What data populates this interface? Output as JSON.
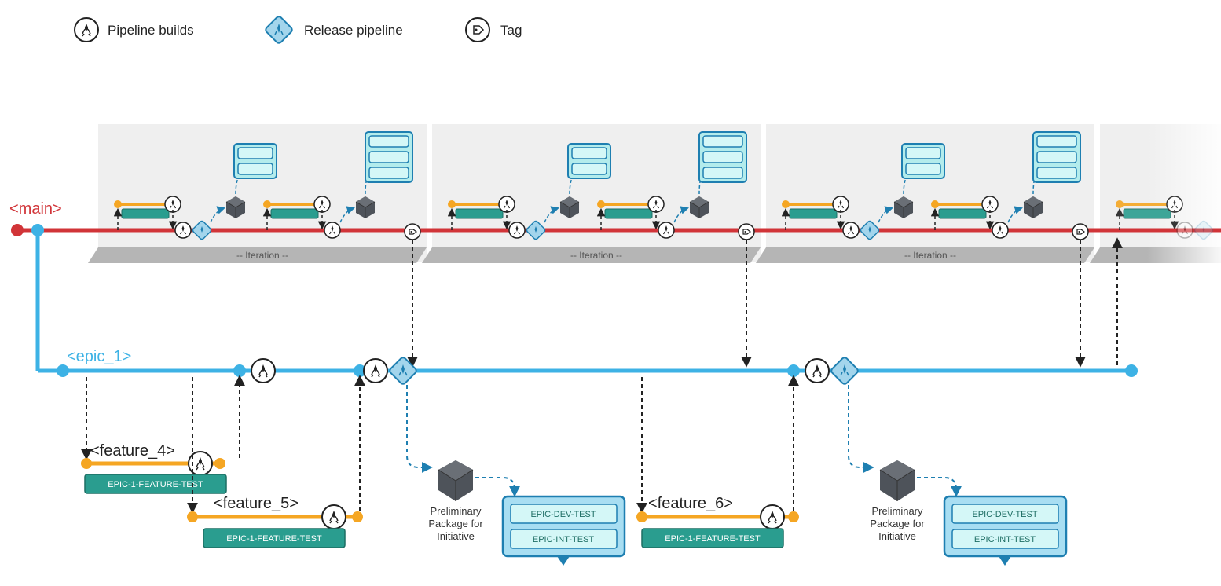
{
  "legend": {
    "pipeline_builds": "Pipeline builds",
    "release_pipeline": "Release pipeline",
    "tag": "Tag"
  },
  "branches": {
    "main": "<main>",
    "epic": "<epic_1>",
    "feature4": "<feature_4>",
    "feature5": "<feature_5>",
    "feature6": "<feature_6>"
  },
  "labels": {
    "iteration": "-- Iteration --",
    "epic_feature_test": "EPIC-1-FEATURE-TEST",
    "epic_dev_test": "EPIC-DEV-TEST",
    "epic_int_test": "EPIC-INT-TEST",
    "package_line1": "Preliminary",
    "package_line2": "Package for",
    "package_line3": "Initiative"
  },
  "colors": {
    "main_branch": "#d13438",
    "epic_branch": "#3db2e5",
    "feature_branch": "#f5a623",
    "test_badge_bg": "#2a9d8f",
    "test_panel_bg": "#d4f1f9",
    "test_panel_border": "#1e7fb1",
    "package_gray": "#4e535a",
    "iteration_bg": "#b5b5b5",
    "panel_gray": "#efefef"
  }
}
